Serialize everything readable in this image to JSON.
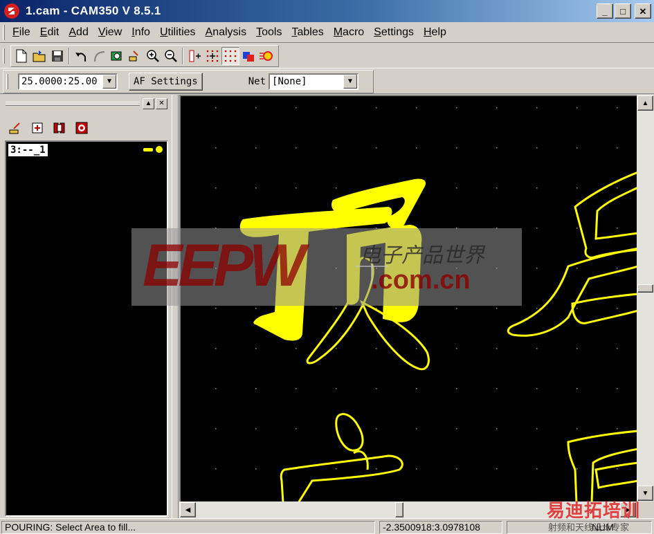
{
  "window": {
    "title": "1.cam - CAM350 V 8.5.1"
  },
  "menu": [
    "File",
    "Edit",
    "Add",
    "View",
    "Info",
    "Utilities",
    "Analysis",
    "Tools",
    "Tables",
    "Macro",
    "Settings",
    "Help"
  ],
  "settings": {
    "grid_value": "25.0000:25.00",
    "af_button": "AF Settings",
    "net_label": "Net",
    "net_value": "[None]"
  },
  "layers": [
    {
      "label": "3:--_1",
      "color": "#ffff00"
    }
  ],
  "canvas": {
    "background": "#000000",
    "trace_color": "#ffff00",
    "characters": [
      "顶",
      "层"
    ]
  },
  "status": {
    "message": "POURING: Select Area to fill...",
    "coordinates": "-2.3500918:3.0978108",
    "num": "NUM"
  },
  "watermark": {
    "logo": "EEPW",
    "tagline": "电子产品世界",
    "domain": ".com.cn",
    "second": "易迪拓培训",
    "second_sub": "射频和天线设计专家"
  }
}
